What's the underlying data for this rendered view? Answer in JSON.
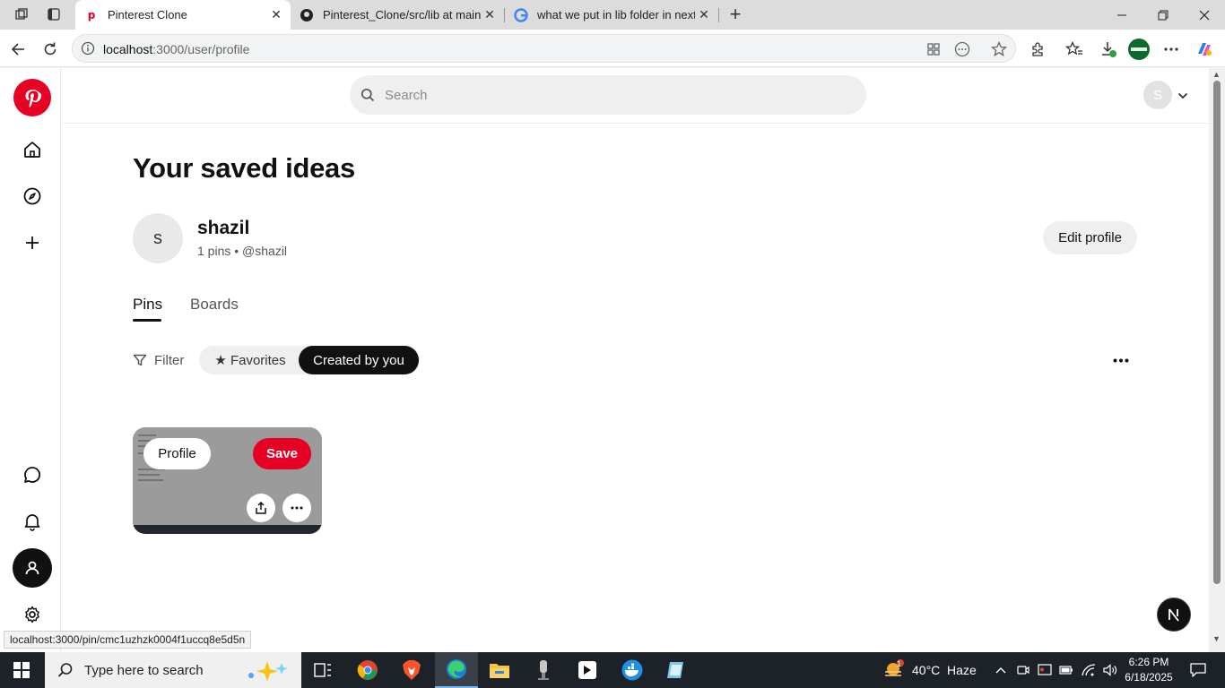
{
  "browser": {
    "tabs": [
      {
        "title": "Pinterest Clone",
        "active": true
      },
      {
        "title": "Pinterest_Clone/src/lib at main · N"
      },
      {
        "title": "what we put in lib folder in nextjs"
      }
    ],
    "new_tab_label": "+",
    "url_host": "localhost",
    "url_path": ":3000/user/profile"
  },
  "header": {
    "search_placeholder": "Search",
    "user_initial": "S"
  },
  "profile": {
    "page_title": "Your saved ideas",
    "avatar_initial": "s",
    "name": "shazil",
    "meta": "1 pins • @shazil",
    "edit_label": "Edit profile"
  },
  "profile_tabs": [
    {
      "label": "Pins",
      "selected": true
    },
    {
      "label": "Boards",
      "selected": false
    }
  ],
  "filters": {
    "filter_label": "Filter",
    "chips": [
      {
        "label": "★ Favorites",
        "selected": false
      },
      {
        "label": "Created by you",
        "selected": true
      }
    ]
  },
  "pin": {
    "profile_label": "Profile",
    "save_label": "Save"
  },
  "status_bar_url": "localhost:3000/pin/cmc1uzhzk0004f1uccq8e5d5n",
  "taskbar": {
    "search_placeholder": "Type here to search",
    "weather": "40°C  Haze",
    "weather_badge": "1",
    "time": "6:26 PM",
    "date": "6/18/2025"
  },
  "colors": {
    "brand": "#e60023",
    "selected_chip": "#111111"
  }
}
